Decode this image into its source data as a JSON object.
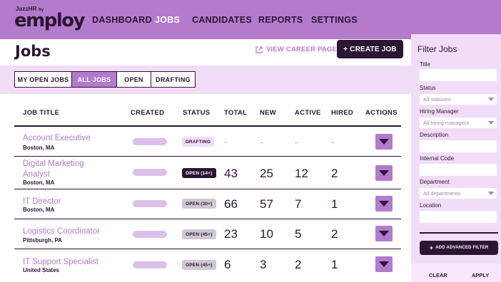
{
  "brand": {
    "small": "JazzHR",
    "tiny": "by",
    "name": "employ"
  },
  "nav": [
    "DASHBOARD",
    "JOBS",
    "CANDIDATES",
    "REPORTS",
    "SETTINGS"
  ],
  "page": {
    "title": "Jobs",
    "career_link": "VIEW CAREER PAGE",
    "create_button": "+ CREATE JOB"
  },
  "tabs": [
    "MY OPEN JOBS",
    "ALL JOBS",
    "OPEN",
    "DRAFTING"
  ],
  "table": {
    "headers": [
      "JOB TITLE",
      "CREATED",
      "STATUS",
      "TOTAL",
      "NEW",
      "ACTIVE",
      "HIRED",
      "ACTIONS"
    ],
    "rows": [
      {
        "title": "Account Executive",
        "location": "Boston, MA",
        "status": "DRAFTING",
        "total": "-",
        "new": "-",
        "active": "-",
        "hired": "-"
      },
      {
        "title": "Digital Marketing Analyst",
        "location": "Boston, MA",
        "status": "OPEN (14+)",
        "total": "43",
        "new": "25",
        "active": "12",
        "hired": "2"
      },
      {
        "title": "IT Director",
        "location": "Boston, MA",
        "status": "OPEN (30+)",
        "total": "66",
        "new": "57",
        "active": "7",
        "hired": "1"
      },
      {
        "title": "Logistics Coordinator",
        "location": "Pittsburgh, PA",
        "status": "OPEN (45+)",
        "total": "23",
        "new": "10",
        "active": "5",
        "hired": "2"
      },
      {
        "title": "IT Support Specialist",
        "location": "United States",
        "status": "OPEN (45+)",
        "total": "6",
        "new": "3",
        "active": "2",
        "hired": "1"
      }
    ]
  },
  "filters": {
    "title": "Filter Jobs",
    "fields": {
      "title": "Title",
      "status": "Status",
      "status_placeholder": "All statuses",
      "manager": "Hiring Manager",
      "manager_placeholder": "All hiring managers",
      "description": "Description",
      "internal_code": "Internal Code",
      "department": "Department",
      "department_placeholder": "All departments",
      "location": "Location"
    },
    "advanced": "ADD ADVANCED FILTER",
    "clear": "CLEAR",
    "apply": "APPLY"
  },
  "colors": {
    "brand": "#b47acc",
    "dark": "#2b1533",
    "band": "#f2ddf8"
  }
}
